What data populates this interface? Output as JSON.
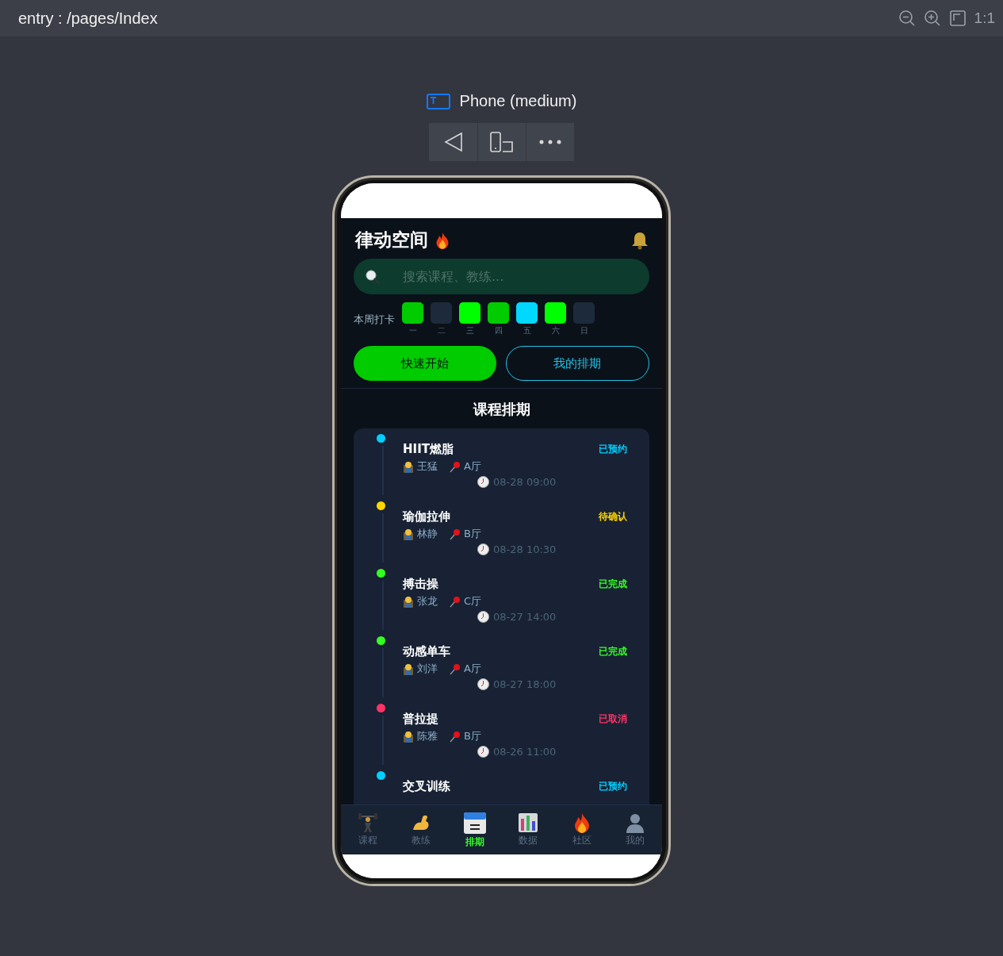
{
  "toolbar": {
    "title": "entry : /pages/Index",
    "zoom_label": "1:1"
  },
  "device": {
    "name": "Phone (medium)"
  },
  "app": {
    "title": "律动空间",
    "search": {
      "placeholder": "搜索课程、教练..."
    },
    "checkin": {
      "label": "本周打卡",
      "days": [
        {
          "label": "一",
          "checked": true,
          "color": "#00cc00"
        },
        {
          "label": "二",
          "checked": false
        },
        {
          "label": "三",
          "checked": true,
          "color": "#00ff00"
        },
        {
          "label": "四",
          "checked": true,
          "color": "#00cc00"
        },
        {
          "label": "五",
          "checked": true,
          "color": "#00d8ff"
        },
        {
          "label": "六",
          "checked": true,
          "color": "#00ff00"
        },
        {
          "label": "日",
          "checked": false
        }
      ]
    },
    "buttons": [
      {
        "label": "快速开始",
        "kind": "primary"
      },
      {
        "label": "我的排期",
        "kind": "outline"
      }
    ],
    "section_title": "课程排期",
    "courses": [
      {
        "title": "HIIT燃脂",
        "status": "已预约",
        "color": "#00cfff",
        "coach": "王猛",
        "room": "A厅",
        "time": "08-28 09:00"
      },
      {
        "title": "瑜伽拉伸",
        "status": "待确认",
        "color": "#ffd500",
        "coach": "林静",
        "room": "B厅",
        "time": "08-28 10:30"
      },
      {
        "title": "搏击操",
        "status": "已完成",
        "color": "#33ff22",
        "coach": "张龙",
        "room": "C厅",
        "time": "08-27 14:00"
      },
      {
        "title": "动感单车",
        "status": "已完成",
        "color": "#33ff22",
        "coach": "刘洋",
        "room": "A厅",
        "time": "08-27 18:00"
      },
      {
        "title": "普拉提",
        "status": "已取消",
        "color": "#ff3366",
        "coach": "陈雅",
        "room": "B厅",
        "time": "08-26 11:00"
      },
      {
        "title": "交叉训练",
        "status": "已预约",
        "color": "#00cfff"
      }
    ],
    "tabs": [
      {
        "label": "课程",
        "kind": "lifter",
        "selected": false
      },
      {
        "label": "教练",
        "kind": "muscle",
        "selected": false
      },
      {
        "label": "排期",
        "kind": "calendar",
        "selected": true
      },
      {
        "label": "数据",
        "kind": "chart",
        "selected": false
      },
      {
        "label": "社区",
        "kind": "fire",
        "selected": false
      },
      {
        "label": "我的",
        "kind": "person",
        "selected": false
      }
    ]
  }
}
